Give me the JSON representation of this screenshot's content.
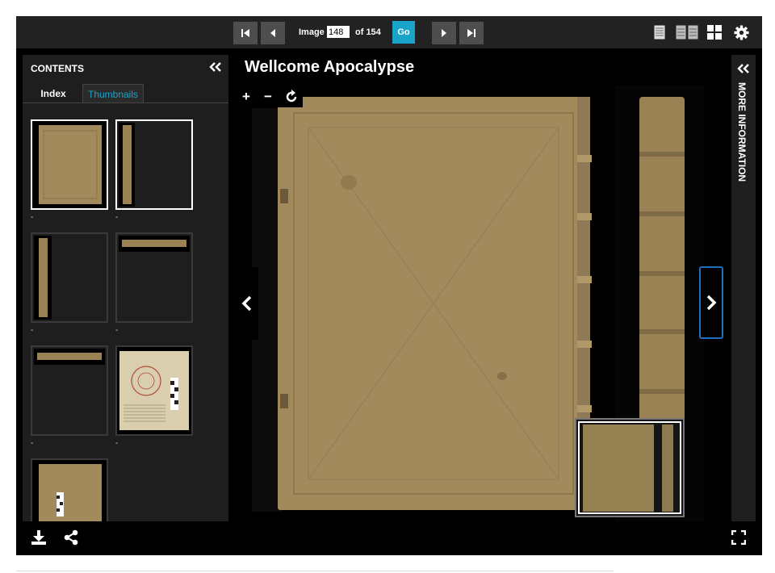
{
  "toolbar": {
    "image_label": "Image",
    "current_image": "148",
    "of_label": "of 154",
    "go_label": "Go"
  },
  "sidebar": {
    "title": "CONTENTS",
    "tabs": [
      {
        "label": "Index",
        "active": false
      },
      {
        "label": "Thumbnails",
        "active": true
      }
    ],
    "thumbnail_captions": [
      "-",
      "-",
      "-",
      "-",
      "-",
      "-"
    ]
  },
  "main": {
    "title": "Wellcome Apocalypse"
  },
  "right_panel": {
    "label": "MORE INFORMATION"
  },
  "colors": {
    "accent": "#1aa3c9",
    "panel": "#1e1e1e",
    "toolbar": "#222222",
    "leather": "#a38a5c"
  },
  "icons": [
    "first-page-icon",
    "previous-page-icon",
    "next-page-icon",
    "last-page-icon",
    "one-up-view-icon",
    "two-up-view-icon",
    "gallery-view-icon",
    "settings-icon",
    "collapse-icon",
    "zoom-in-icon",
    "zoom-out-icon",
    "rotate-icon",
    "download-icon",
    "share-icon",
    "fullscreen-icon"
  ]
}
